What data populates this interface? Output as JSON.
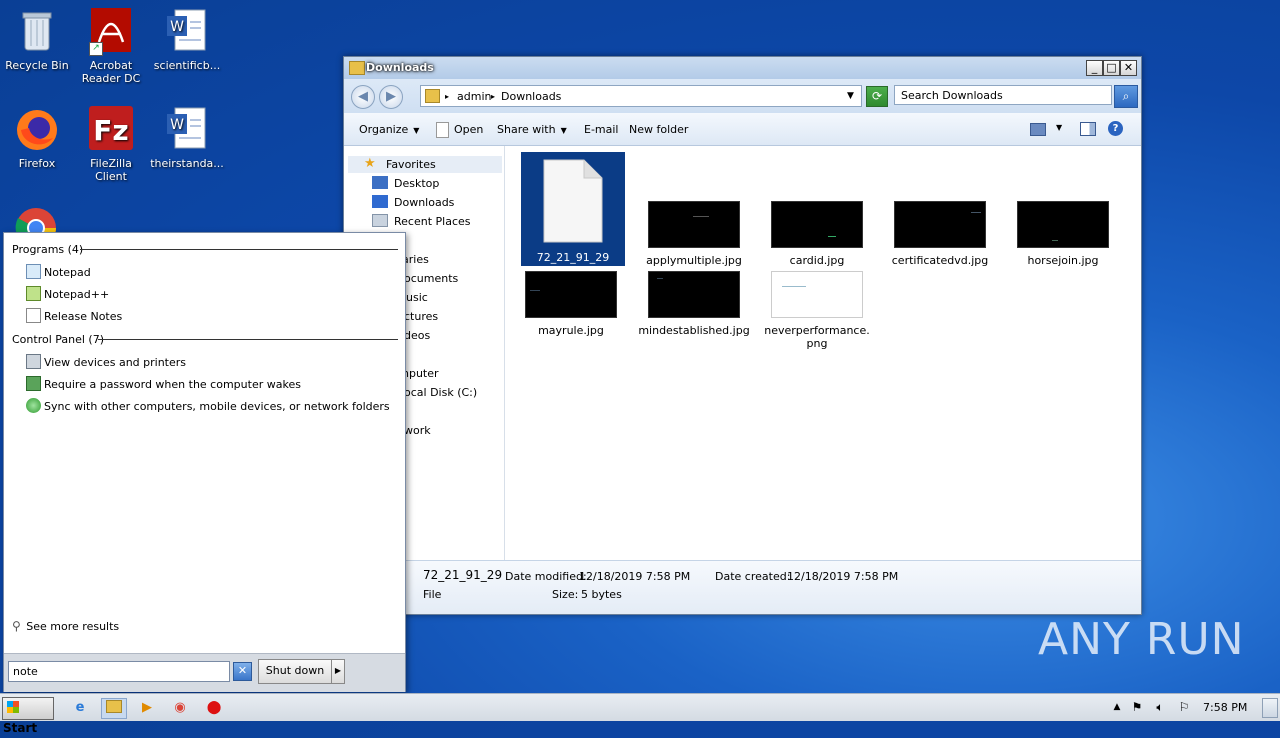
{
  "desktop": {
    "icons": [
      {
        "label": "Recycle Bin"
      },
      {
        "label": "Acrobat Reader DC"
      },
      {
        "label": "scientificb..."
      },
      {
        "label": "Firefox"
      },
      {
        "label": "FileZilla Client"
      },
      {
        "label": "theirstanda..."
      }
    ]
  },
  "explorer": {
    "title": "Downloads",
    "breadcrumb": [
      "admin",
      "Downloads"
    ],
    "search_placeholder": "Search Downloads",
    "toolbar": {
      "organize": "Organize",
      "open": "Open",
      "share_with": "Share with",
      "email": "E-mail",
      "new_folder": "New folder"
    },
    "nav": {
      "favorites": "Favorites",
      "desktop": "Desktop",
      "downloads": "Downloads",
      "recent_places": "Recent Places",
      "libraries_partial": "aries",
      "documents_partial": "ocuments",
      "music_partial": "usic",
      "pictures_partial": "ctures",
      "videos_partial": "deos",
      "computer_partial": "nputer",
      "local_disk_partial": "ocal Disk (C:)",
      "network_partial": "work"
    },
    "files": [
      {
        "name": "72_21_91_29",
        "kind": "blank",
        "selected": true
      },
      {
        "name": "applymultiple.jpg",
        "kind": "dark"
      },
      {
        "name": "cardid.jpg",
        "kind": "dark"
      },
      {
        "name": "certificatedvd.jpg",
        "kind": "dark"
      },
      {
        "name": "horsejoin.jpg",
        "kind": "dark"
      },
      {
        "name": "mayrule.jpg",
        "kind": "dark"
      },
      {
        "name": "mindestablished.jpg",
        "kind": "dark"
      },
      {
        "name": "neverperformance.png",
        "line1": "neverperformance.",
        "line2": "png",
        "kind": "light"
      }
    ],
    "details": {
      "name": "72_21_91_29",
      "type": "File",
      "date_modified_label": "Date modified:",
      "date_modified": "12/18/2019 7:58 PM",
      "date_created_label": "Date created:",
      "date_created": "12/18/2019 7:58 PM",
      "size_label": "Size:",
      "size": "5 bytes"
    }
  },
  "start_menu": {
    "programs_header": "Programs (4)",
    "programs": [
      "Notepad",
      "Notepad++",
      "Release Notes"
    ],
    "control_panel_header": "Control Panel (7)",
    "control_panel": [
      "View devices and printers",
      "Require a password when the computer wakes",
      "Sync with other computers, mobile devices, or network folders"
    ],
    "see_more": "See more results",
    "search_value": "note",
    "shutdown": "Shut down"
  },
  "taskbar": {
    "start_label": "Start",
    "clock": "7:58 PM"
  },
  "watermark": "ANY RUN"
}
